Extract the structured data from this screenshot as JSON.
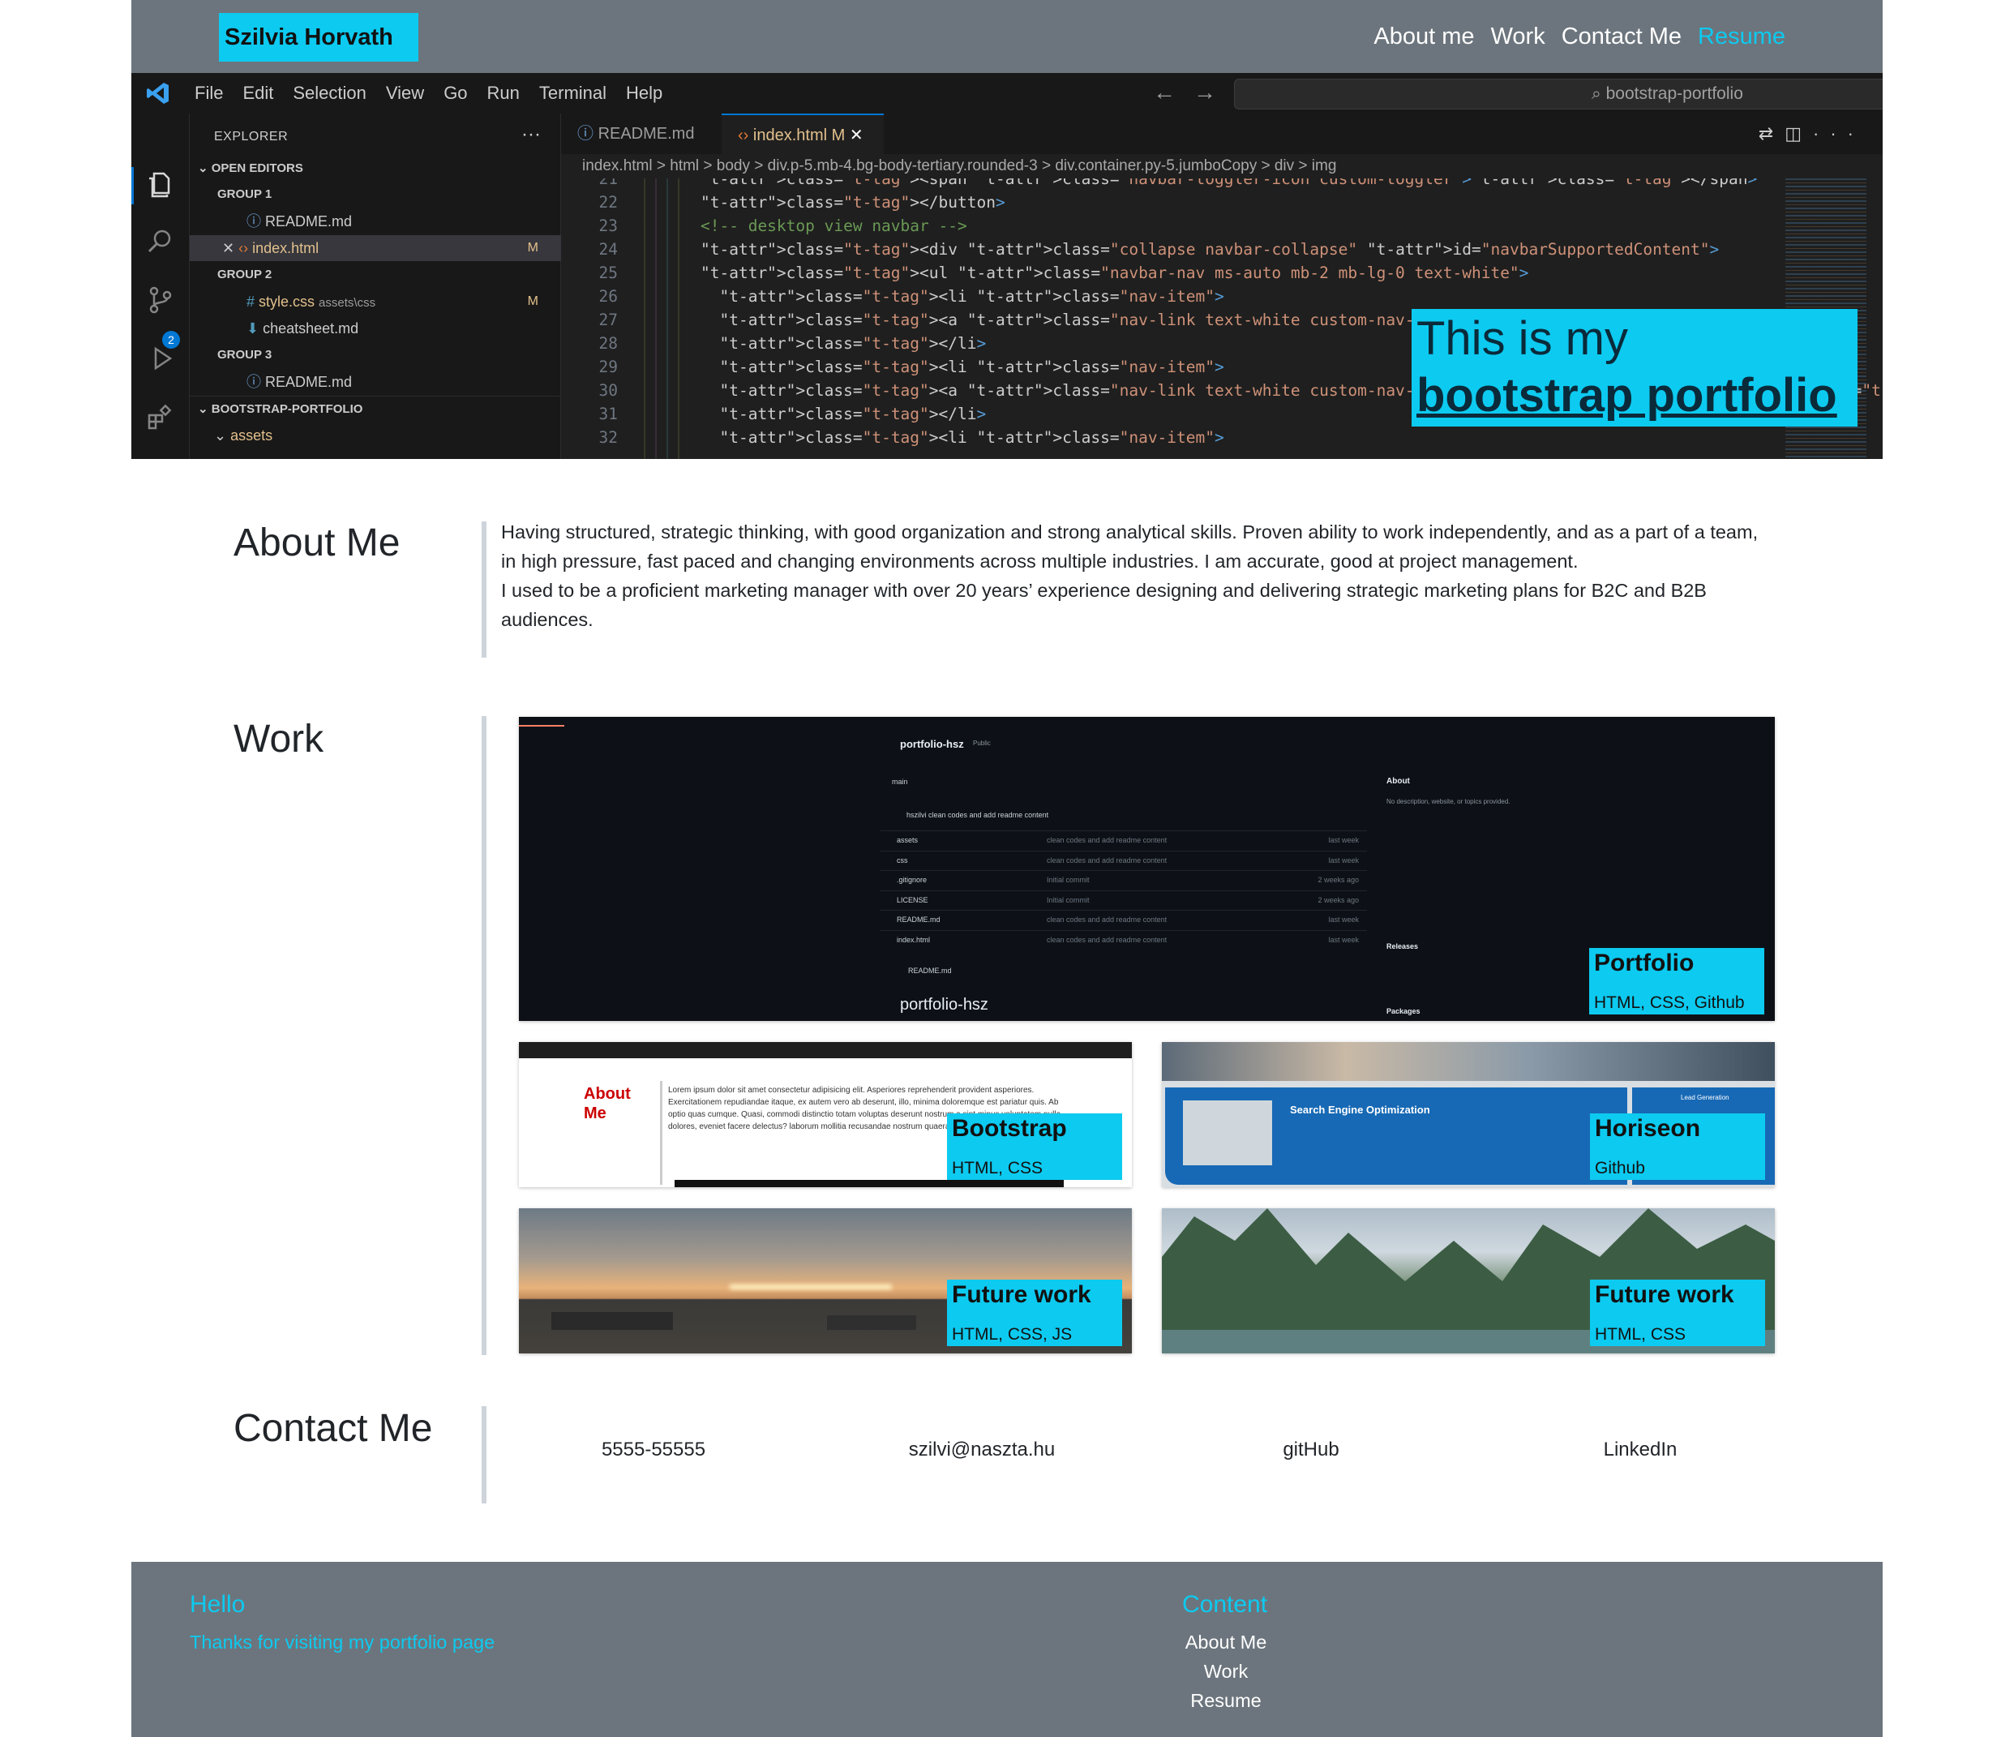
{
  "navbar": {
    "brand": "Szilvia Horvath",
    "links": [
      "About me",
      "Work",
      "Contact Me",
      "Resume"
    ]
  },
  "hero": {
    "caption_line1": "This is my",
    "caption_line2": "bootstrap portfolio",
    "vscode": {
      "menu": [
        "File",
        "Edit",
        "Selection",
        "View",
        "Go",
        "Run",
        "Terminal",
        "Help"
      ],
      "search": "bootstrap-portfolio",
      "explorer_title": "EXPLORER",
      "sidebar_rows": [
        {
          "text": "OPEN EDITORS",
          "kind": "section"
        },
        {
          "text": "GROUP 1",
          "kind": "group"
        },
        {
          "text": "README.md",
          "kind": "file"
        },
        {
          "text": "index.html",
          "kind": "file-sel",
          "mod": "M"
        },
        {
          "text": "GROUP 2",
          "kind": "group"
        },
        {
          "text": "style.css",
          "extra": "assets\\css",
          "kind": "file-yellow",
          "mod": "M"
        },
        {
          "text": "cheatsheet.md",
          "kind": "file"
        },
        {
          "text": "GROUP 3",
          "kind": "group"
        },
        {
          "text": "README.md",
          "kind": "file"
        },
        {
          "text": "BOOTSTRAP-PORTFOLIO",
          "kind": "section"
        },
        {
          "text": "assets",
          "kind": "folder-yellow"
        }
      ],
      "badge": "2",
      "tabs": [
        {
          "label": "README.md"
        },
        {
          "label": "index.html M"
        }
      ],
      "breadcrumbs": "index.html  >  html  >  body  >  div.p-5.mb-4.bg-body-tertiary.rounded-3  >  div.container.py-5.jumboCopy  >  div  >  img",
      "code_lines": [
        {
          "n": "21",
          "c": "<span class=\"navbar-toggler-icon custom-toggler\"></span>"
        },
        {
          "n": "22",
          "c": "</button>"
        },
        {
          "n": "23",
          "c": "<!-- desktop view navbar -->"
        },
        {
          "n": "24",
          "c": "<div class=\"collapse navbar-collapse\" id=\"navbarSupportedContent\">"
        },
        {
          "n": "25",
          "c": "<ul class=\"navbar-nav ms-auto mb-2 mb-lg-0 text-white\">"
        },
        {
          "n": "26",
          "c": "  <li class=\"nav-item\">"
        },
        {
          "n": "27",
          "c": "  <a class=\"nav-link text-white custom-nav-link\" href=\"#about\">About"
        },
        {
          "n": "28",
          "c": "  </li>"
        },
        {
          "n": "29",
          "c": "  <li class=\"nav-item\">"
        },
        {
          "n": "30",
          "c": "  <a class=\"nav-link text-white custom-nav-link\" href=\"#work\">Work</a>"
        },
        {
          "n": "31",
          "c": "  </li>"
        },
        {
          "n": "32",
          "c": "  <li class=\"nav-item\">"
        }
      ]
    }
  },
  "about": {
    "title": "About Me",
    "line1": "Having structured, strategic thinking, with good organization and strong analytical skills. Proven ability to work independently, and as a part of a team, in high pressure, fast paced and changing environments across multiple industries. I am accurate, good at project management.",
    "line2": "I used to be a proficient marketing manager with over 20 years’ experience designing and delivering strategic marketing plans for B2C and B2B audiences."
  },
  "work": {
    "title": "Work",
    "cards": [
      {
        "title": "Portfolio",
        "tags": "HTML, CSS, Github"
      },
      {
        "title": "Bootstrap",
        "tags": "HTML, CSS"
      },
      {
        "title": "Horiseon",
        "tags": "Github"
      },
      {
        "title": "Future work",
        "tags": "HTML, CSS, JS"
      },
      {
        "title": "Future work",
        "tags": "HTML, CSS"
      }
    ],
    "github_mock": {
      "repo": "portfolio-hsz",
      "visibility": "Public",
      "branch": "main",
      "commit": "hszilvi clean codes and add readme content",
      "files": [
        {
          "name": "assets",
          "msg": "clean codes and add readme content",
          "when": "last week"
        },
        {
          "name": "css",
          "msg": "clean codes and add readme content",
          "when": "last week"
        },
        {
          "name": ".gitignore",
          "msg": "Initial commit",
          "when": "2 weeks ago"
        },
        {
          "name": "LICENSE",
          "msg": "Initial commit",
          "when": "2 weeks ago"
        },
        {
          "name": "README.md",
          "msg": "clean codes and add readme content",
          "when": "last week"
        },
        {
          "name": "index.html",
          "msg": "clean codes and add readme content",
          "when": "last week"
        }
      ],
      "about_label": "About",
      "about_desc": "No description, website, or topics provided.",
      "readme": "README.md",
      "releases": "Releases",
      "packages": "Packages"
    },
    "bootstrap_mock": {
      "heading1": "About",
      "heading2": "Me",
      "lorem": "Lorem ipsum dolor sit amet consectetur adipisicing elit. Asperiores reprehenderit provident asperiores. Exercitationem repudiandae itaque, ex autem vero ab deserunt, illo, minima doloremque est pariatur quis. Ab optio quas cumque. Quasi, commodi distinctio totam voluptas deserunt nostrum a sint minus voluptatem nulla dolores, eveniet facere delectus? laborum mollitia recusandae nostrum quaerat quae eius!"
    },
    "seo_mock": {
      "title": "Search Engine Optimization",
      "side": "Lead Generation"
    }
  },
  "contact": {
    "title": "Contact Me",
    "items": [
      "5555-55555",
      "szilvi@naszta.hu",
      "gitHub",
      "LinkedIn"
    ]
  },
  "footer": {
    "hello": "Hello",
    "thanks": "Thanks for visiting my portfolio page",
    "content": "Content",
    "links": [
      "About Me",
      "Work",
      "Resume"
    ]
  },
  "colors": {
    "accent": "#0dcaf0",
    "nav_bg": "#6c757d",
    "divider": "#ced4da"
  }
}
